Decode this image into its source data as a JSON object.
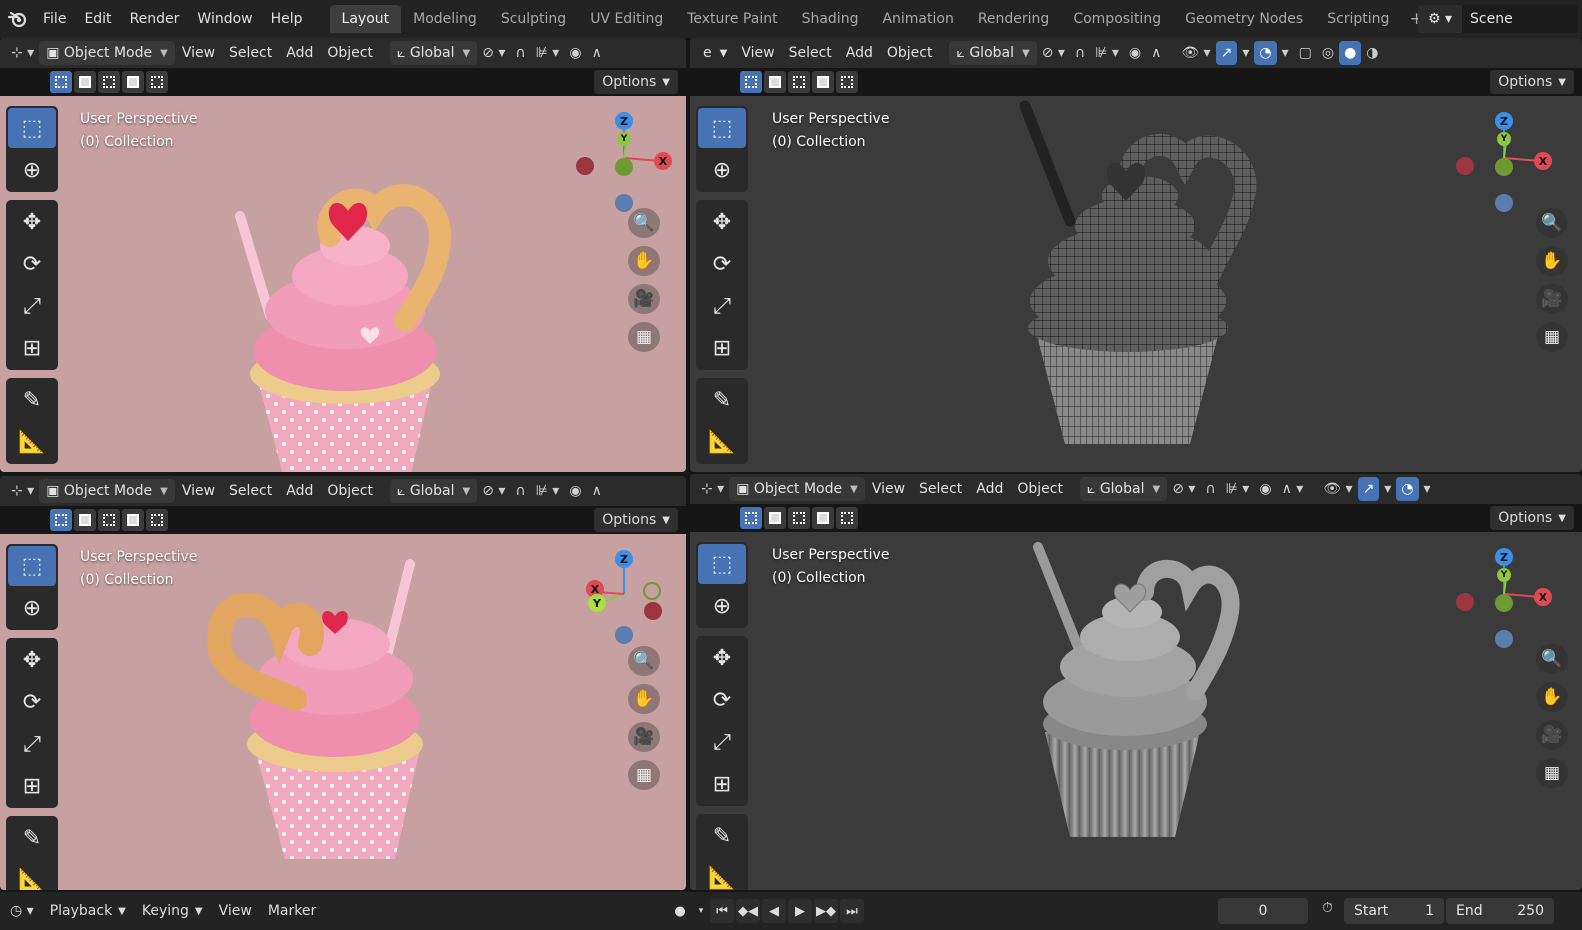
{
  "topbar": {
    "menus": [
      "File",
      "Edit",
      "Render",
      "Window",
      "Help"
    ],
    "workspaces": [
      "Layout",
      "Modeling",
      "Sculpting",
      "UV Editing",
      "Texture Paint",
      "Shading",
      "Animation",
      "Rendering",
      "Compositing",
      "Geometry Nodes",
      "Scripting"
    ],
    "active_workspace": "Layout",
    "add_label": "+",
    "scene_name": "Scene"
  },
  "viewports": [
    {
      "mode": "Object Mode",
      "menus": [
        "View",
        "Select",
        "Add",
        "Object"
      ],
      "orientation": "Global",
      "options": "Options",
      "label": "User Perspective",
      "collection": "(0) Collection",
      "shading": "material"
    },
    {
      "mode": "e",
      "menus": [
        "View",
        "Select",
        "Add",
        "Object"
      ],
      "orientation": "Global",
      "options": "Options",
      "label": "User Perspective",
      "collection": "(0) Collection",
      "shading": "wireframe"
    },
    {
      "mode": "Object Mode",
      "menus": [
        "View",
        "Select",
        "Add",
        "Object"
      ],
      "orientation": "Global",
      "options": "Options",
      "label": "User Perspective",
      "collection": "(0) Collection",
      "shading": "material"
    },
    {
      "mode": "Object Mode",
      "menus": [
        "View",
        "Select",
        "Add",
        "Object"
      ],
      "orientation": "Global",
      "options": "Options",
      "label": "User Perspective",
      "collection": "(0) Collection",
      "shading": "solid"
    }
  ],
  "gizmo_axes": {
    "x": "X",
    "y": "Y",
    "z": "Z"
  },
  "axis_colors": {
    "x": "#e04a55",
    "y": "#8ec63f",
    "z": "#3d8ee6"
  },
  "timeline": {
    "menus": [
      "Playback",
      "Keying",
      "View",
      "Marker"
    ],
    "current_frame": "0",
    "start_label": "Start",
    "start": "1",
    "end_label": "End",
    "end": "250"
  },
  "colors": {
    "accent": "#4772b3",
    "pink_bg": "#c7a0a1",
    "dark_bg": "#3b3b3b"
  }
}
